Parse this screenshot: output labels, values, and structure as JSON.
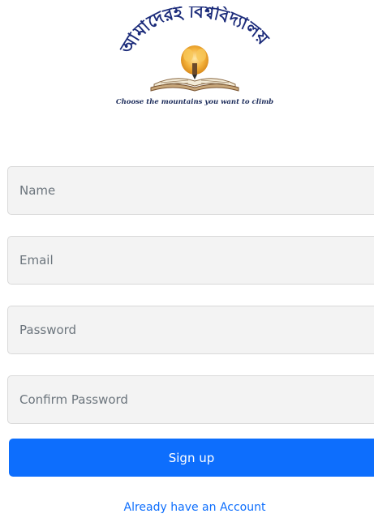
{
  "logo": {
    "title_text": "আমাদেরই বিশ্ববিদ্যালয়",
    "tagline": "Choose the mountains you want to climb",
    "colors": {
      "title": "#1b2b7a",
      "flame": "#f0b030",
      "book": "#c8a77a"
    }
  },
  "form": {
    "name_placeholder": "Name",
    "email_placeholder": "Email",
    "password_placeholder": "Password",
    "confirm_placeholder": "Confirm Password",
    "submit_label": "Sign up",
    "account_link": "Already have an Account"
  },
  "colors": {
    "primary": "#0d6efd",
    "field_bg": "#f3f3f3",
    "field_border": "#d9d9d9"
  }
}
